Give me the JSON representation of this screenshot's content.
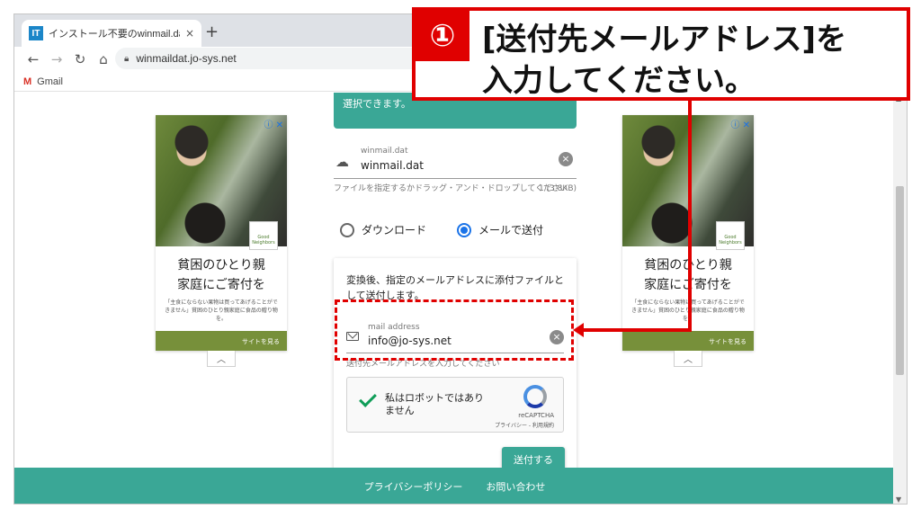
{
  "browser": {
    "tab_title": "インストール不要のwinmail.dat変換",
    "tab_favicon": "IT",
    "tab_close": "×",
    "new_tab": "+",
    "url": "winmaildat.jo-sys.net",
    "bookmark_gmail": "Gmail",
    "gmail_icon": "M"
  },
  "ads": {
    "headline_line1": "貧困のひとり親",
    "headline_line2": "家庭にご寄付を",
    "small_text": "「主食にならない果物は買ってあげることができません」貧困のひとり親家庭に食品の贈り物を。",
    "cta": "サイトを見る",
    "badge": "Good Neighbors",
    "info_icon": "ⓘ ✕",
    "toggle_icon": "︿"
  },
  "form": {
    "select_button_text": "選択できます。",
    "file_label": "winmail.dat",
    "file_name": "winmail.dat",
    "file_hint": "ファイルを指定するかドラッグ・アンド・ドロップしてください",
    "file_size": "1 (3.8KB)",
    "radio_download": "ダウンロード",
    "radio_email": "メールで送付",
    "card_description": "変換後、指定のメールアドレスに添付ファイルとして送付します。",
    "email_label": "mail address",
    "email_value": "info@jo-sys.net",
    "email_hint": "送付先メールアドレスを入力してください",
    "captcha_text": "私はロボットではありません",
    "recaptcha_brand": "reCAPTCHA",
    "recaptcha_links": "プライバシー - 利用規約",
    "send_button": "送付する"
  },
  "footer": {
    "privacy": "プライバシーポリシー",
    "contact": "お問い合わせ"
  },
  "annotation": {
    "number": "①",
    "line1": "[送付先メールアドレス]を",
    "line2": "入力してください。",
    "color": "#e00000"
  },
  "colors": {
    "accent": "#3aa796"
  }
}
